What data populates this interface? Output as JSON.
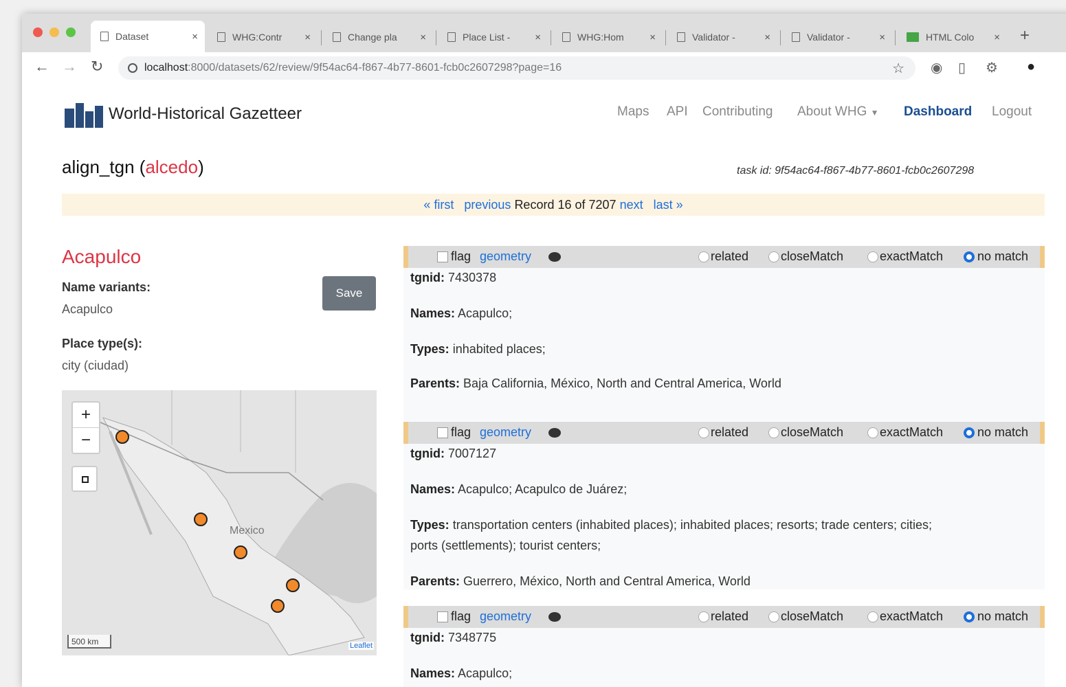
{
  "browser": {
    "tabs": [
      {
        "label": "Dataset",
        "active": true
      },
      {
        "label": "WHG:Contr",
        "active": false
      },
      {
        "label": "Change pla",
        "active": false
      },
      {
        "label": "Place List -",
        "active": false
      },
      {
        "label": "WHG:Hom",
        "active": false
      },
      {
        "label": "Validator -",
        "active": false
      },
      {
        "label": "Validator -",
        "active": false
      },
      {
        "label": "HTML Colo",
        "active": false
      }
    ],
    "url_host": "localhost",
    "url_rest": ":8000/datasets/62/review/9f54ac64-f867-4b77-8601-fcb0c2607298?page=16"
  },
  "site": {
    "title": "World-Historical Gazetteer",
    "nav": [
      "Maps",
      "API",
      "Contributing",
      "About WHG",
      "Dashboard",
      "Logout"
    ]
  },
  "task": {
    "title": "align_tgn",
    "dataset": "alcedo",
    "task_id": "task id: 9f54ac64-f867-4b77-8601-fcb0c2607298"
  },
  "pager": {
    "first": "« first",
    "previous": "previous",
    "record": "Record 16 of 7207",
    "next": "next",
    "last": "last »"
  },
  "place": {
    "name": "Acapulco",
    "variants_label": "Name variants:",
    "variants": "Acapulco",
    "types_label": "Place type(s):",
    "types": "city (ciudad)",
    "save": "Save"
  },
  "map": {
    "country_label": "Mexico",
    "scale": "500 km",
    "attribution": "Leaflet",
    "zoom_in": "+",
    "zoom_out": "−"
  },
  "match_ui": {
    "flag": "flag",
    "geometry": "geometry",
    "options": [
      "related",
      "closeMatch",
      "exactMatch",
      "no match"
    ],
    "tgnid_label": "tgnid:",
    "names_label": "Names:",
    "types_label": "Types:",
    "parents_label": "Parents:"
  },
  "matches": [
    {
      "tgnid": "7430378",
      "names": "Acapulco;",
      "types": "inhabited places;",
      "types2": "",
      "parents": "Baja California, México, North and Central America, World"
    },
    {
      "tgnid": "7007127",
      "names": "Acapulco; Acapulco de Juárez;",
      "types": "transportation centers (inhabited places); inhabited places; resorts; trade centers; cities;",
      "types2": "ports (settlements); tourist centers;",
      "parents": "Guerrero, México, North and Central America, World"
    },
    {
      "tgnid": "7348775",
      "names": "Acapulco;",
      "types": "",
      "types2": "",
      "parents": ""
    }
  ],
  "colors": {
    "accent": "#1e6fd9",
    "brand_red": "#dc3545",
    "marker": "#f28a2c"
  }
}
